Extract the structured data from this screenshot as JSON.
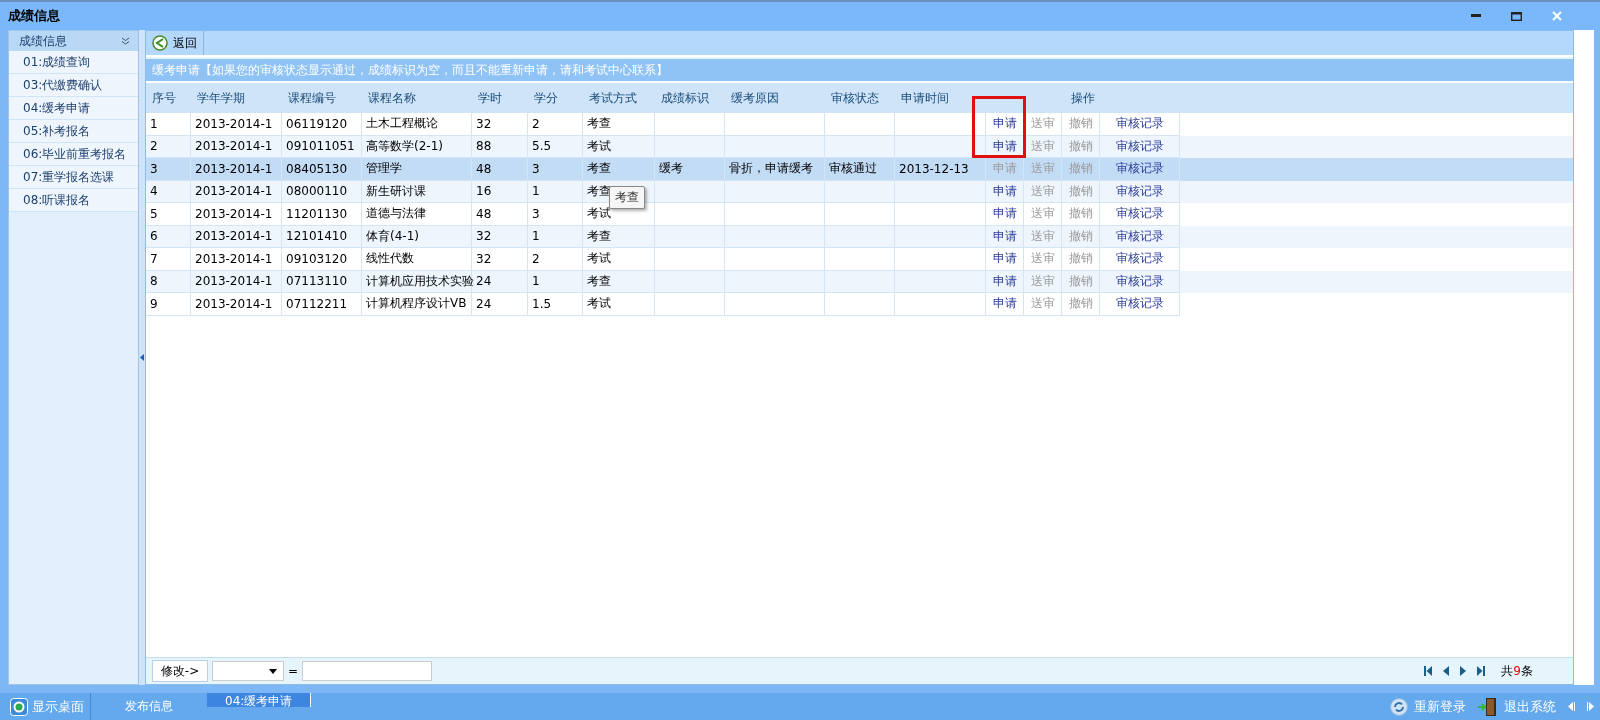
{
  "window": {
    "title": "成绩信息"
  },
  "sidebar": {
    "title": "成绩信息",
    "items": [
      "01:成绩查询",
      "03:代缴费确认",
      "04:缓考申请",
      "05:补考报名",
      "06:毕业前重考报名",
      "07:重学报名选课",
      "08:听课报名"
    ]
  },
  "toolbar": {
    "back": "返回"
  },
  "notice": "缓考申请【如果您的审核状态显示通过，成绩标识为空，而且不能重新申请，请和考试中心联系】",
  "table": {
    "columns": [
      "序号",
      "学年学期",
      "课程编号",
      "课程名称",
      "学时",
      "学分",
      "考试方式",
      "成绩标识",
      "缓考原因",
      "审核状态",
      "申请时间"
    ],
    "actions_heading": "操作",
    "rows": [
      {
        "selected": false,
        "marked": true,
        "cells": [
          "1",
          "2013-2014-1",
          "06119120",
          "土木工程概论",
          "32",
          "2",
          "考查",
          "",
          "",
          "",
          ""
        ],
        "actions": [
          {
            "label": "申请",
            "disabled": false
          },
          {
            "label": "送审",
            "disabled": true
          },
          {
            "label": "撤销",
            "disabled": true
          },
          {
            "label": "审核记录",
            "disabled": false
          }
        ]
      },
      {
        "selected": false,
        "marked": true,
        "cells": [
          "2",
          "2013-2014-1",
          "091011051",
          "高等数学(2-1)",
          "88",
          "5.5",
          "考试",
          "",
          "",
          "",
          ""
        ],
        "actions": [
          {
            "label": "申请",
            "disabled": false
          },
          {
            "label": "送审",
            "disabled": true
          },
          {
            "label": "撤销",
            "disabled": true
          },
          {
            "label": "审核记录",
            "disabled": false
          }
        ]
      },
      {
        "selected": true,
        "marked": false,
        "cells": [
          "3",
          "2013-2014-1",
          "08405130",
          "管理学",
          "48",
          "3",
          "考查",
          "缓考",
          "骨折，申请缓考",
          "审核通过",
          "2013-12-13"
        ],
        "actions": [
          {
            "label": "申请",
            "disabled": true
          },
          {
            "label": "送审",
            "disabled": true
          },
          {
            "label": "撤销",
            "disabled": true
          },
          {
            "label": "审核记录",
            "disabled": false
          }
        ]
      },
      {
        "selected": false,
        "marked": false,
        "cells": [
          "4",
          "2013-2014-1",
          "08000110",
          "新生研讨课",
          "16",
          "1",
          "考查",
          "",
          "",
          "",
          ""
        ],
        "actions": [
          {
            "label": "申请",
            "disabled": false
          },
          {
            "label": "送审",
            "disabled": true
          },
          {
            "label": "撤销",
            "disabled": true
          },
          {
            "label": "审核记录",
            "disabled": false
          }
        ]
      },
      {
        "selected": false,
        "marked": false,
        "cells": [
          "5",
          "2013-2014-1",
          "11201130",
          "道德与法律",
          "48",
          "3",
          "考试",
          "",
          "",
          "",
          ""
        ],
        "actions": [
          {
            "label": "申请",
            "disabled": false
          },
          {
            "label": "送审",
            "disabled": true
          },
          {
            "label": "撤销",
            "disabled": true
          },
          {
            "label": "审核记录",
            "disabled": false
          }
        ]
      },
      {
        "selected": false,
        "marked": false,
        "cells": [
          "6",
          "2013-2014-1",
          "12101410",
          "体育(4-1)",
          "32",
          "1",
          "考查",
          "",
          "",
          "",
          ""
        ],
        "actions": [
          {
            "label": "申请",
            "disabled": false
          },
          {
            "label": "送审",
            "disabled": true
          },
          {
            "label": "撤销",
            "disabled": true
          },
          {
            "label": "审核记录",
            "disabled": false
          }
        ]
      },
      {
        "selected": false,
        "marked": false,
        "cells": [
          "7",
          "2013-2014-1",
          "09103120",
          "线性代数",
          "32",
          "2",
          "考试",
          "",
          "",
          "",
          ""
        ],
        "actions": [
          {
            "label": "申请",
            "disabled": false
          },
          {
            "label": "送审",
            "disabled": true
          },
          {
            "label": "撤销",
            "disabled": true
          },
          {
            "label": "审核记录",
            "disabled": false
          }
        ]
      },
      {
        "selected": false,
        "marked": false,
        "cells": [
          "8",
          "2013-2014-1",
          "07113110",
          "计算机应用技术实验",
          "24",
          "1",
          "考查",
          "",
          "",
          "",
          ""
        ],
        "actions": [
          {
            "label": "申请",
            "disabled": false
          },
          {
            "label": "送审",
            "disabled": true
          },
          {
            "label": "撤销",
            "disabled": true
          },
          {
            "label": "审核记录",
            "disabled": false
          }
        ]
      },
      {
        "selected": false,
        "marked": false,
        "cells": [
          "9",
          "2013-2014-1",
          "07112211",
          "计算机程序设计VB",
          "24",
          "1.5",
          "考试",
          "",
          "",
          "",
          ""
        ],
        "actions": [
          {
            "label": "申请",
            "disabled": false
          },
          {
            "label": "送审",
            "disabled": true
          },
          {
            "label": "撤销",
            "disabled": true
          },
          {
            "label": "审核记录",
            "disabled": false
          }
        ]
      }
    ]
  },
  "tooltip": {
    "text": "考查"
  },
  "footer": {
    "edit_button": "修改->",
    "equals": "=",
    "total_prefix": "共",
    "total_count": "9",
    "total_suffix": "条"
  },
  "taskbar": {
    "desktop": "显示桌面",
    "tasks": [
      {
        "label": "发布信息",
        "selected": false
      },
      {
        "label": "04:缓考申请",
        "selected": true
      }
    ],
    "relogin": "重新登录",
    "exit": "退出系统"
  }
}
